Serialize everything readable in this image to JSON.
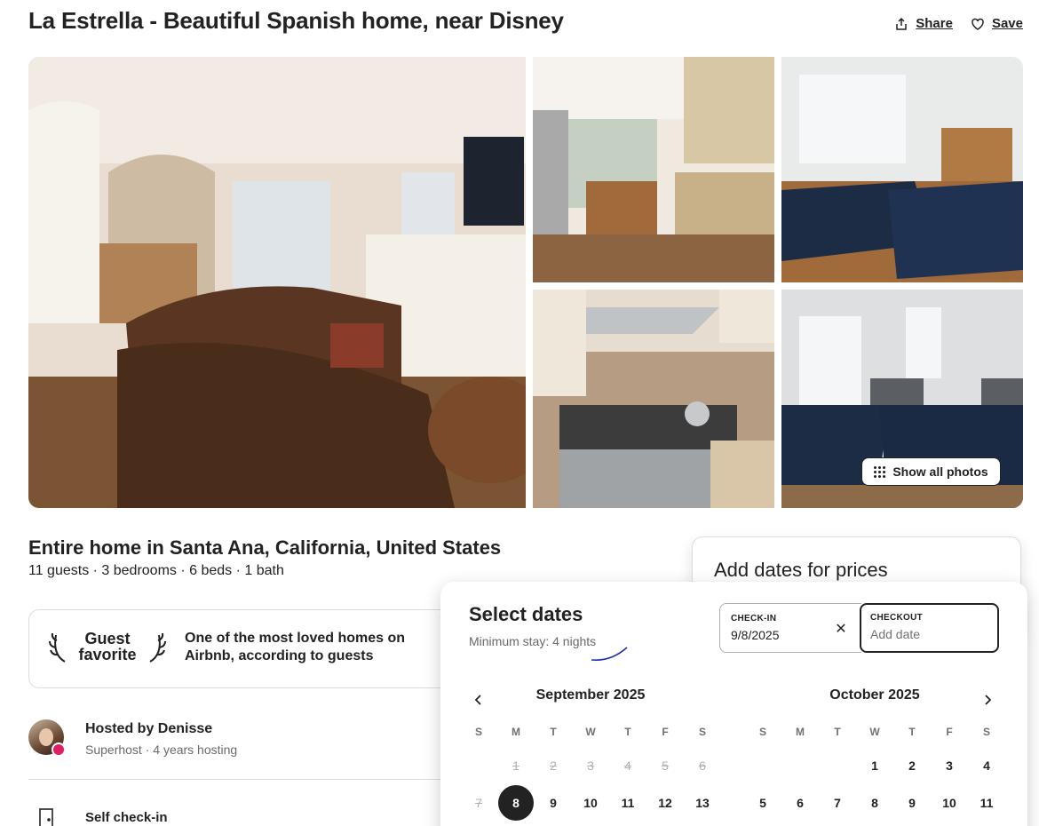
{
  "listing": {
    "title": "La Estrella - Beautiful Spanish home, near Disney",
    "type": "Entire home in Santa Ana, California, United States",
    "summary": "11 guests · 3 bedrooms · 6 beds · 1 bath"
  },
  "actions": {
    "share": "Share",
    "save": "Save",
    "show_all_photos": "Show all photos"
  },
  "photos": [
    {
      "name": "living-room",
      "icon": "photo"
    },
    {
      "name": "kitchen-island",
      "icon": "photo"
    },
    {
      "name": "bedroom-1",
      "icon": "photo"
    },
    {
      "name": "kitchen-range",
      "icon": "photo"
    },
    {
      "name": "bedroom-2",
      "icon": "photo"
    }
  ],
  "guest_favorite": {
    "badge": "Guest favorite",
    "description": "One of the most loved homes on Airbnb, according to guests"
  },
  "host": {
    "name": "Hosted by Denisse",
    "meta": "Superhost · 4 years hosting"
  },
  "amenity": {
    "self_checkin": "Self check-in"
  },
  "booking": {
    "title": "Add dates for prices"
  },
  "calendar": {
    "title": "Select dates",
    "min_stay": "Minimum stay: 4 nights",
    "checkin_label": "CHECK-IN",
    "checkin_value": "9/8/2025",
    "checkout_label": "CHECKOUT",
    "checkout_placeholder": "Add date",
    "clear": "✕",
    "weekdays": [
      "S",
      "M",
      "T",
      "W",
      "T",
      "F",
      "S"
    ],
    "months": [
      {
        "title": "September 2025",
        "offset": 1,
        "days": [
          "1",
          "2",
          "3",
          "4",
          "5",
          "6",
          "7",
          "8",
          "9",
          "10",
          "11",
          "12",
          "13"
        ],
        "past_through": 7,
        "selected": 8
      },
      {
        "title": "October 2025",
        "offset": 3,
        "days": [
          "1",
          "2",
          "3",
          "4",
          "5",
          "6",
          "7",
          "8",
          "9",
          "10",
          "11"
        ],
        "past_through": 0,
        "selected": 0
      }
    ]
  },
  "colors": {
    "text": "#222222",
    "muted": "#6a6a6a",
    "selected": "#222222",
    "superhost": "#e31c5f"
  }
}
